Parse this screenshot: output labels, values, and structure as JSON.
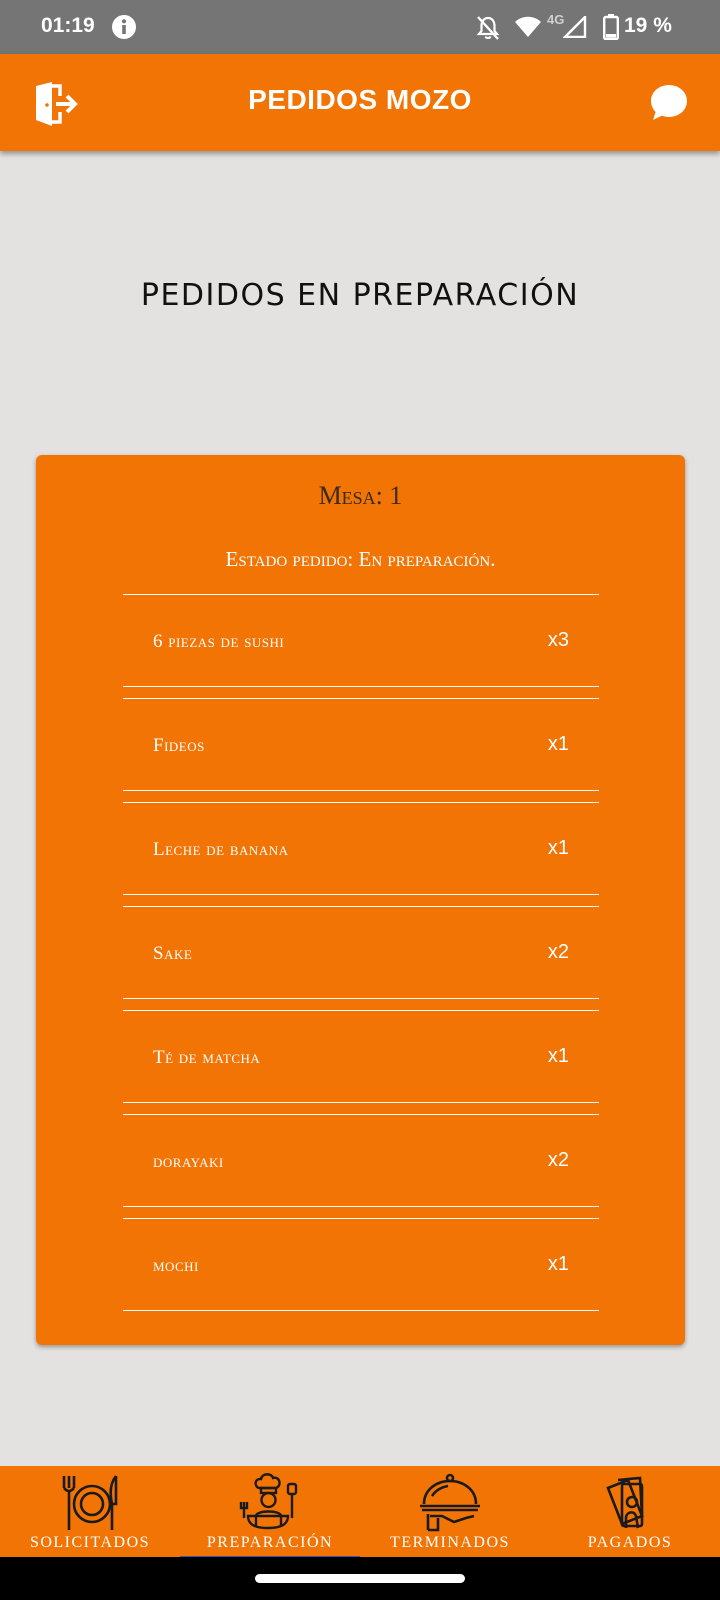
{
  "status_bar": {
    "time": "01:19",
    "network": "4G",
    "battery": "19 %",
    "icons": [
      "info-icon",
      "bell-off-icon",
      "wifi-icon",
      "signal-icon",
      "battery-icon"
    ]
  },
  "app_bar": {
    "title": "PEDIDOS MOZO",
    "left_icon": "logout-icon",
    "right_icon": "chat-icon"
  },
  "page": {
    "title": "PEDIDOS EN PREPARACIÓN"
  },
  "order": {
    "mesa": "Mesa: 1",
    "estado": "Estado pedido: En preparación.",
    "items": [
      {
        "name": "6 piezas de sushi",
        "qty": "x3"
      },
      {
        "name": "Fideos",
        "qty": "x1"
      },
      {
        "name": "Leche de banana",
        "qty": "x1"
      },
      {
        "name": "Sake",
        "qty": "x2"
      },
      {
        "name": "Té de matcha",
        "qty": "x1"
      },
      {
        "name": "dorayaki",
        "qty": "x2"
      },
      {
        "name": "mochi",
        "qty": "x1"
      }
    ]
  },
  "bottom_nav": {
    "items": [
      {
        "label": "SOLICITADOS",
        "icon": "plate-cutlery-icon"
      },
      {
        "label": "PREPARACIÓN",
        "icon": "chef-icon"
      },
      {
        "label": "TERMINADOS",
        "icon": "serving-cloche-icon"
      },
      {
        "label": "PAGADOS",
        "icon": "payment-icon"
      }
    ],
    "active_index": 1
  },
  "colors": {
    "accent": "#f27405",
    "background": "#e4e2e1",
    "status_bar": "#757575",
    "indicator": "#3f51b5"
  }
}
